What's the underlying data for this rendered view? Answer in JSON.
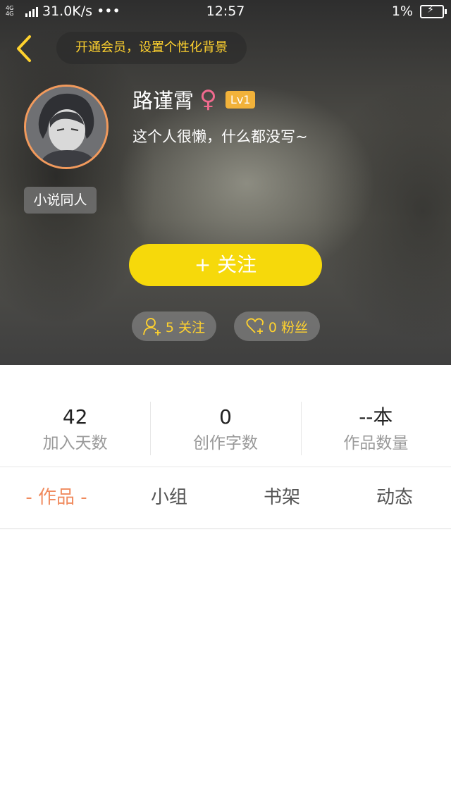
{
  "status_bar": {
    "network": "4G 4G",
    "speed": "31.0K/s",
    "more": "•••",
    "time": "12:57",
    "battery": "1%"
  },
  "header": {
    "vip_prompt": "开通会员，设置个性化背景"
  },
  "profile": {
    "name": "路谨霄",
    "gender_symbol": "♀",
    "level": "Lv1",
    "bio": "这个人很懒，什么都没写~",
    "tag": "小说同人",
    "follow_label": "+  关注",
    "following": "5 关注",
    "fans": "0 粉丝"
  },
  "stats": [
    {
      "value": "42",
      "label": "加入天数"
    },
    {
      "value": "0",
      "label": "创作字数"
    },
    {
      "value": "--本",
      "label": "作品数量"
    }
  ],
  "tabs": [
    {
      "label": "- 作品 -",
      "active": true
    },
    {
      "label": "小组",
      "active": false
    },
    {
      "label": "书架",
      "active": false
    },
    {
      "label": "动态",
      "active": false
    }
  ],
  "colors": {
    "accent_yellow": "#f6d90b",
    "active_tab": "#f08a5d",
    "gender_pink": "#f06a8e",
    "level_badge": "#f2b23a",
    "avatar_ring": "#f29a5c"
  }
}
